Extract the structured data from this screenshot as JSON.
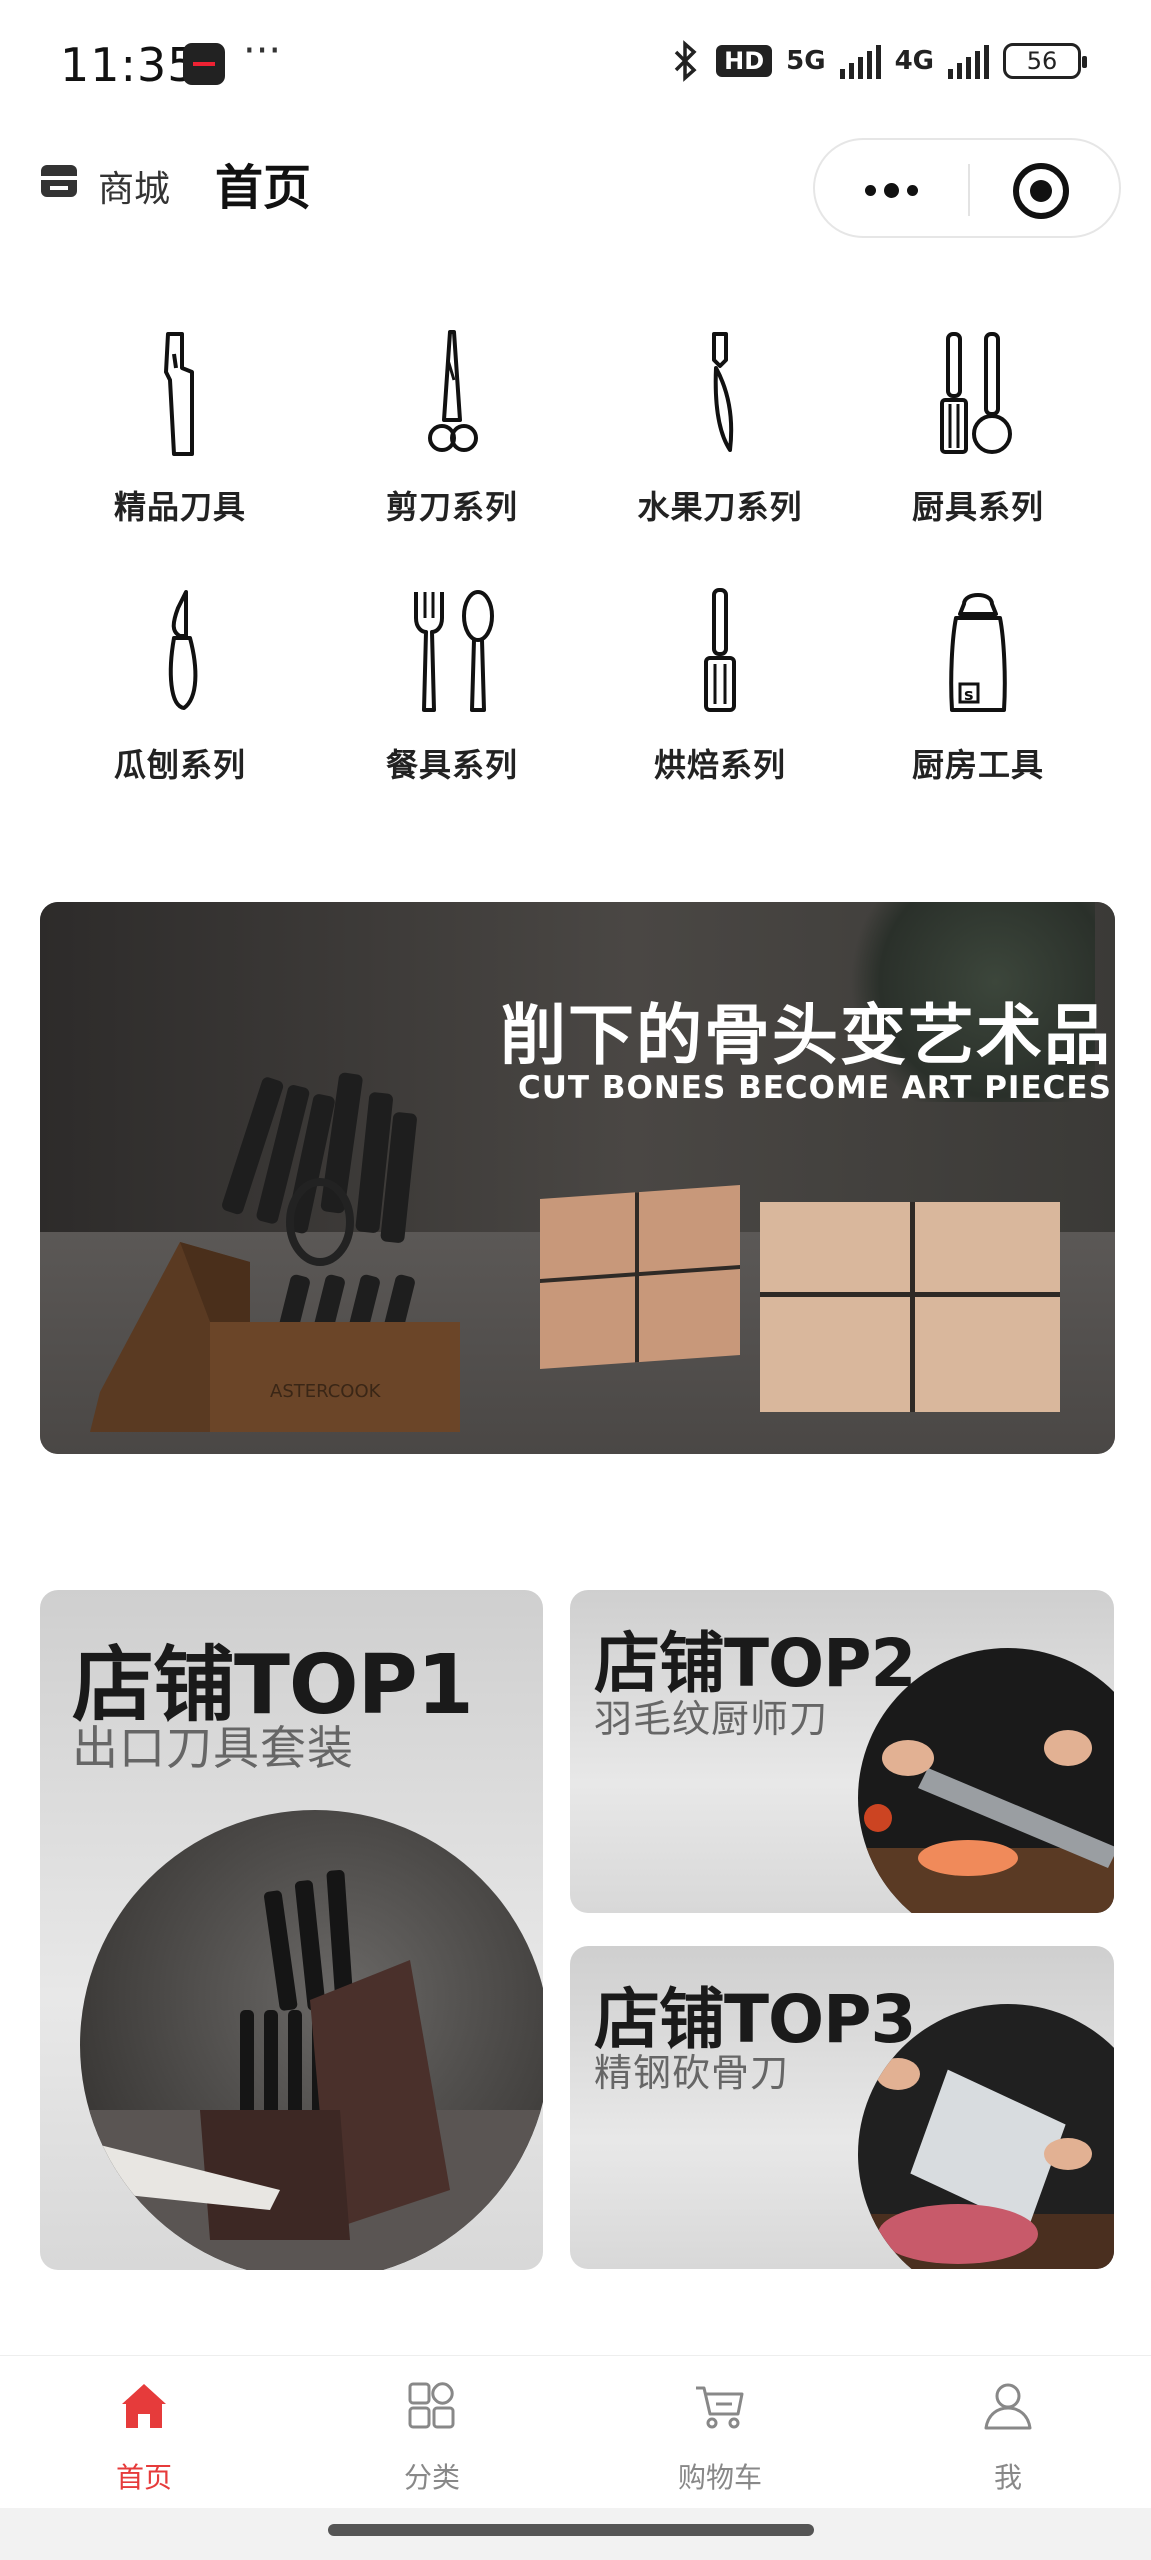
{
  "status_bar": {
    "time": "11:35",
    "more": "···",
    "hd": "HD",
    "net1": "5G",
    "net2": "4G",
    "battery": "56"
  },
  "header": {
    "shop_label": "商城",
    "title": "首页"
  },
  "categories": [
    {
      "label": "精品刀具",
      "icon": "cleaver-icon"
    },
    {
      "label": "剪刀系列",
      "icon": "scissors-icon"
    },
    {
      "label": "水果刀系列",
      "icon": "fruit-knife-icon"
    },
    {
      "label": "厨具系列",
      "icon": "kitchen-utensils-icon"
    },
    {
      "label": "瓜刨系列",
      "icon": "peeler-icon"
    },
    {
      "label": "餐具系列",
      "icon": "fork-spoon-icon"
    },
    {
      "label": "烘焙系列",
      "icon": "spatula-icon"
    },
    {
      "label": "厨房工具",
      "icon": "salt-shaker-icon"
    }
  ],
  "banner": {
    "headline": "削下的骨头变艺术品",
    "subline": "CUT BONES BECOME ART PIECES",
    "brand_mark": "ASTERCOOK"
  },
  "top_products": [
    {
      "title": "店铺TOP1",
      "subtitle": "出口刀具套装"
    },
    {
      "title": "店铺TOP2",
      "subtitle": "羽毛纹厨师刀"
    },
    {
      "title": "店铺TOP3",
      "subtitle": "精钢砍骨刀"
    }
  ],
  "tabbar": {
    "tabs": [
      {
        "label": "首页",
        "icon": "home-icon",
        "active": true
      },
      {
        "label": "分类",
        "icon": "category-grid-icon",
        "active": false
      },
      {
        "label": "购物车",
        "icon": "cart-icon",
        "active": false
      },
      {
        "label": "我",
        "icon": "user-icon",
        "active": false
      }
    ],
    "active_color": "#e63b3b"
  }
}
